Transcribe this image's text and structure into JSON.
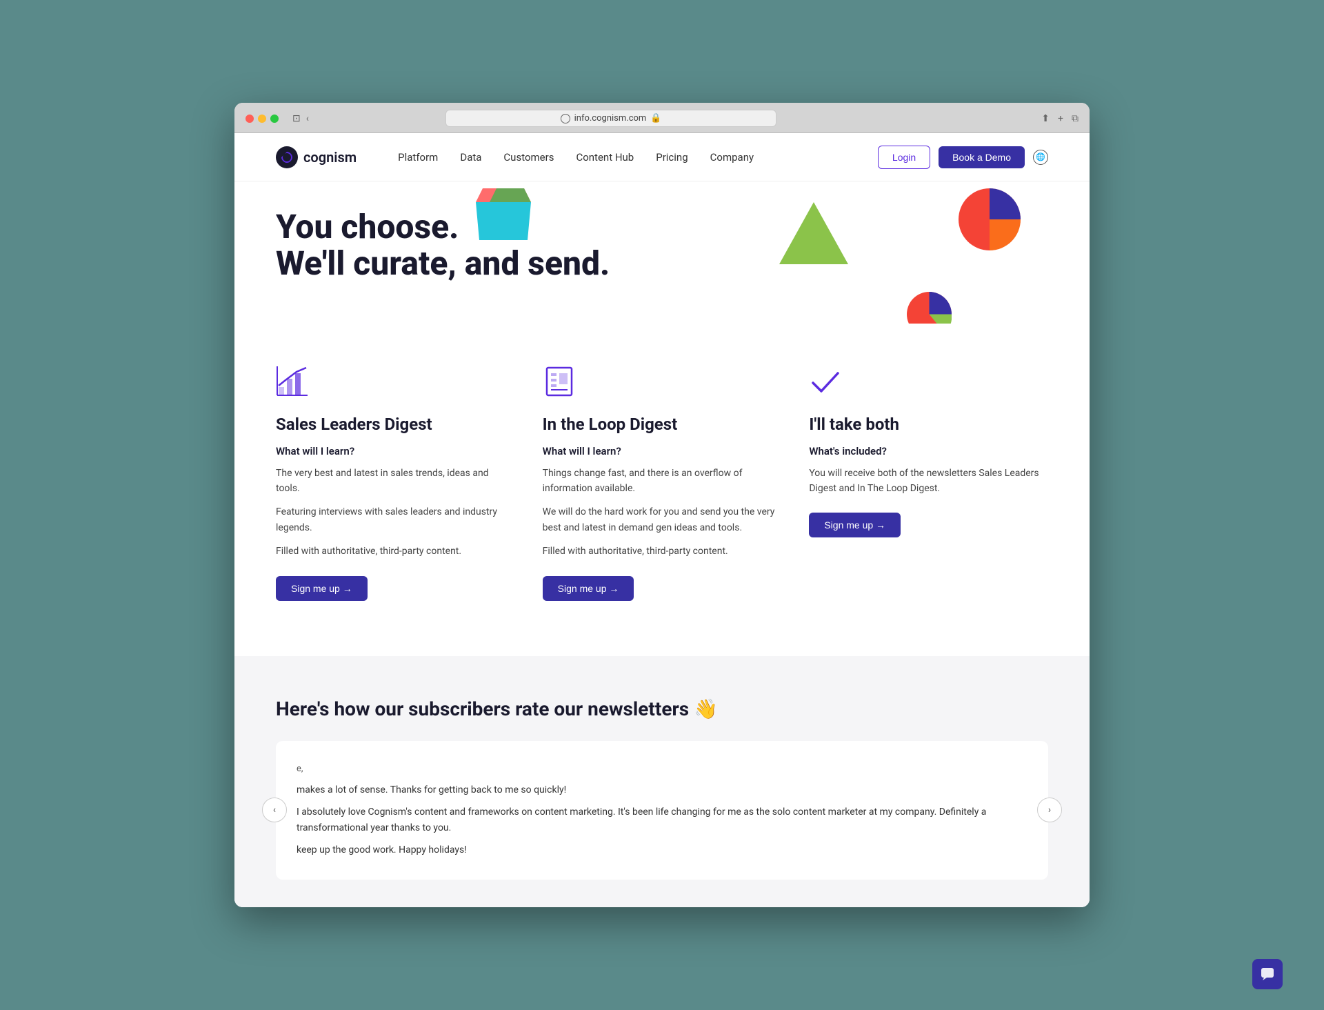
{
  "browser": {
    "url": "info.cognism.com",
    "lock_icon": "🔒"
  },
  "navbar": {
    "logo_text": "cognism",
    "nav_items": [
      "Platform",
      "Data",
      "Customers",
      "Content Hub",
      "Pricing",
      "Company"
    ],
    "login_label": "Login",
    "demo_label": "Book a Demo"
  },
  "hero": {
    "title_line1": "You choose.",
    "title_line2": "We'll curate, and send."
  },
  "cards": [
    {
      "id": "sales-leaders",
      "title": "Sales Leaders Digest",
      "subtitle": "What will I learn?",
      "paragraphs": [
        "The very best and latest in sales trends, ideas and tools.",
        "Featuring interviews with sales leaders and industry legends.",
        "Filled with authoritative, third-party content."
      ],
      "cta": "Sign me up →"
    },
    {
      "id": "in-the-loop",
      "title": "In the Loop Digest",
      "subtitle": "What will I learn?",
      "paragraphs": [
        "Things change fast, and there is an overflow of information available.",
        "We will do the hard work for you and send you the very best and latest in demand gen ideas and tools.",
        "Filled with authoritative, third-party content."
      ],
      "cta": "Sign me up →"
    },
    {
      "id": "take-both",
      "title": "I'll take both",
      "subtitle": "What's included?",
      "paragraphs": [
        "You will receive both of the newsletters Sales Leaders Digest and In The Loop Digest."
      ],
      "cta": "Sign me up →"
    }
  ],
  "testimonials": {
    "section_title": "Here's how our subscribers rate our newsletters 👋",
    "emoji": "👋",
    "lines": [
      "e,",
      "makes a lot of sense. Thanks for getting back to me so quickly!",
      "I absolutely love Cognism's content and frameworks on content marketing. It's been life changing for me as the solo content marketer at my company. Definitely a transformational year thanks to you.",
      "keep up the good work. Happy holidays!"
    ]
  },
  "chat": {
    "icon": "💬"
  }
}
